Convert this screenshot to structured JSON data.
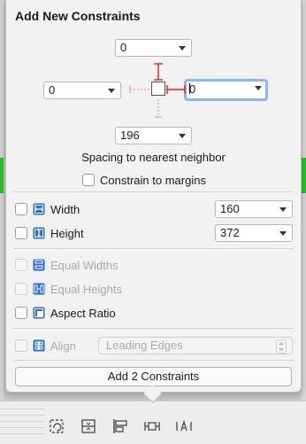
{
  "colors": {
    "accent_blue": "#2e6bd0",
    "strut_red": "#e02020",
    "focus_ring": "#8db8ef"
  },
  "popover": {
    "title": "Add New Constraints",
    "spacing": {
      "top": {
        "value": "0"
      },
      "left": {
        "value": "0"
      },
      "right": {
        "value": "0",
        "focused": true
      },
      "bottom": {
        "value": "196"
      }
    },
    "spacing_label": "Spacing to nearest neighbor",
    "constrain_to_margins": {
      "label": "Constrain to margins",
      "checked": false
    },
    "width": {
      "label": "Width",
      "value": "160",
      "checked": false,
      "icon": "width-icon"
    },
    "height": {
      "label": "Height",
      "value": "372",
      "checked": false,
      "icon": "height-icon"
    },
    "equal_widths": {
      "label": "Equal Widths",
      "enabled": false,
      "icon": "equal-widths-icon"
    },
    "equal_heights": {
      "label": "Equal Heights",
      "enabled": false,
      "icon": "equal-heights-icon"
    },
    "aspect_ratio": {
      "label": "Aspect Ratio",
      "checked": false,
      "icon": "aspect-ratio-icon"
    },
    "align": {
      "label": "Align",
      "enabled": false,
      "value": "Leading Edges",
      "icon": "align-icon"
    },
    "add_button": {
      "label": "Add 2 Constraints"
    }
  },
  "bottom_toolbar": {
    "buttons": [
      {
        "icon": "update-frames-icon"
      },
      {
        "icon": "stack-icon"
      },
      {
        "icon": "align-toolbar-icon"
      },
      {
        "icon": "pin-icon"
      },
      {
        "icon": "resolve-issues-icon"
      }
    ]
  }
}
